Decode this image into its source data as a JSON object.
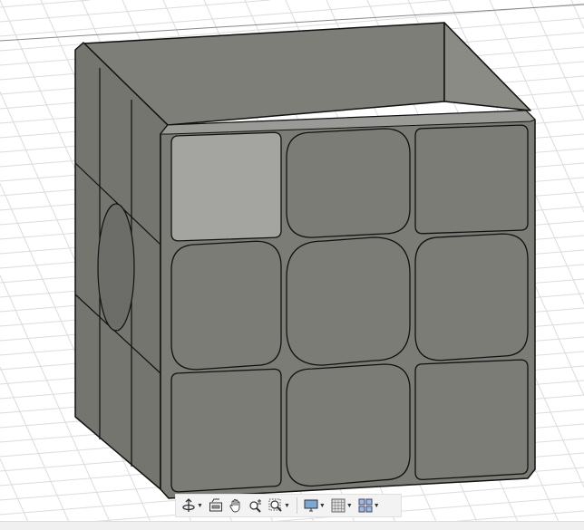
{
  "viewport": {
    "model": "cube",
    "colors": {
      "body": "#7b7c76",
      "body_dark": "#6c6d68",
      "selected_face": "#a4a5a1",
      "edge": "#111111",
      "grid": "#d9d9d9",
      "background": "#ffffff"
    },
    "selected_tile": "front-top-left"
  },
  "navigation_toolbar": {
    "items": [
      {
        "name": "orbit",
        "icon": "orbit-icon",
        "has_menu": true
      },
      {
        "name": "look-at",
        "icon": "look-at-icon",
        "has_menu": false
      },
      {
        "name": "pan",
        "icon": "hand-icon",
        "has_menu": false
      },
      {
        "name": "zoom",
        "icon": "zoom-icon",
        "has_menu": false
      },
      {
        "name": "fit",
        "icon": "zoom-window-icon",
        "has_menu": true
      },
      {
        "name": "display-settings",
        "icon": "monitor-icon",
        "has_menu": true
      },
      {
        "name": "grid-and-snaps",
        "icon": "grid-icon",
        "has_menu": true
      },
      {
        "name": "viewports",
        "icon": "viewports-icon",
        "has_menu": true
      }
    ]
  }
}
